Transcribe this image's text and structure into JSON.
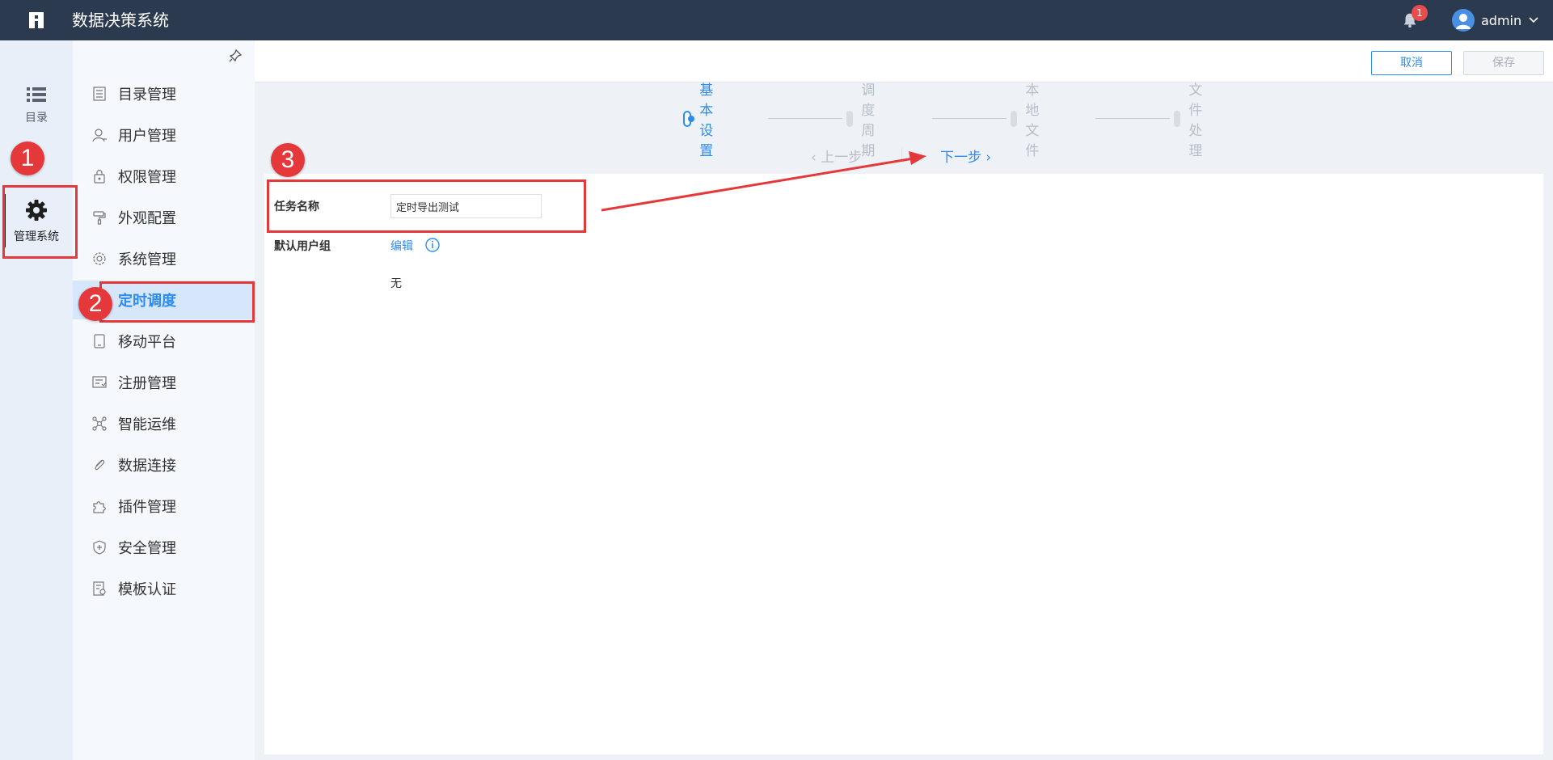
{
  "header": {
    "app_title": "数据决策系统",
    "notification_count": "1",
    "user_name": "admin"
  },
  "rail": {
    "directory_label": "目录",
    "admin_label": "管理系统"
  },
  "menu": {
    "items": [
      {
        "label": "目录管理",
        "icon": "catalog-icon"
      },
      {
        "label": "用户管理",
        "icon": "user-icon"
      },
      {
        "label": "权限管理",
        "icon": "lock-icon"
      },
      {
        "label": "外观配置",
        "icon": "paint-roller-icon"
      },
      {
        "label": "系统管理",
        "icon": "gear-icon"
      },
      {
        "label": "定时调度",
        "icon": "clock-icon",
        "active": true
      },
      {
        "label": "移动平台",
        "icon": "tablet-icon"
      },
      {
        "label": "注册管理",
        "icon": "register-icon"
      },
      {
        "label": "智能运维",
        "icon": "network-icon"
      },
      {
        "label": "数据连接",
        "icon": "paperclip-icon"
      },
      {
        "label": "插件管理",
        "icon": "puzzle-icon"
      },
      {
        "label": "安全管理",
        "icon": "shield-icon"
      },
      {
        "label": "模板认证",
        "icon": "template-check-icon"
      }
    ]
  },
  "toolbar": {
    "cancel_label": "取消",
    "save_label": "保存"
  },
  "steps": [
    {
      "label": "基本设置",
      "current": true
    },
    {
      "label": "调度周期"
    },
    {
      "label": "本地文件"
    },
    {
      "label": "文件处理"
    }
  ],
  "nav": {
    "prev_label": "上一步",
    "next_label": "下一步"
  },
  "form": {
    "task_name_label": "任务名称",
    "task_name_value": "定时导出测试",
    "user_group_label": "默认用户组",
    "edit_label": "编辑",
    "user_group_value": "无"
  },
  "annotations": [
    "1",
    "2",
    "3"
  ],
  "colors": {
    "header_bg": "#2c3a4f",
    "accent": "#2d8cf0",
    "annotation": "#e5383b",
    "active_menu_bg": "#d6e7fb"
  }
}
